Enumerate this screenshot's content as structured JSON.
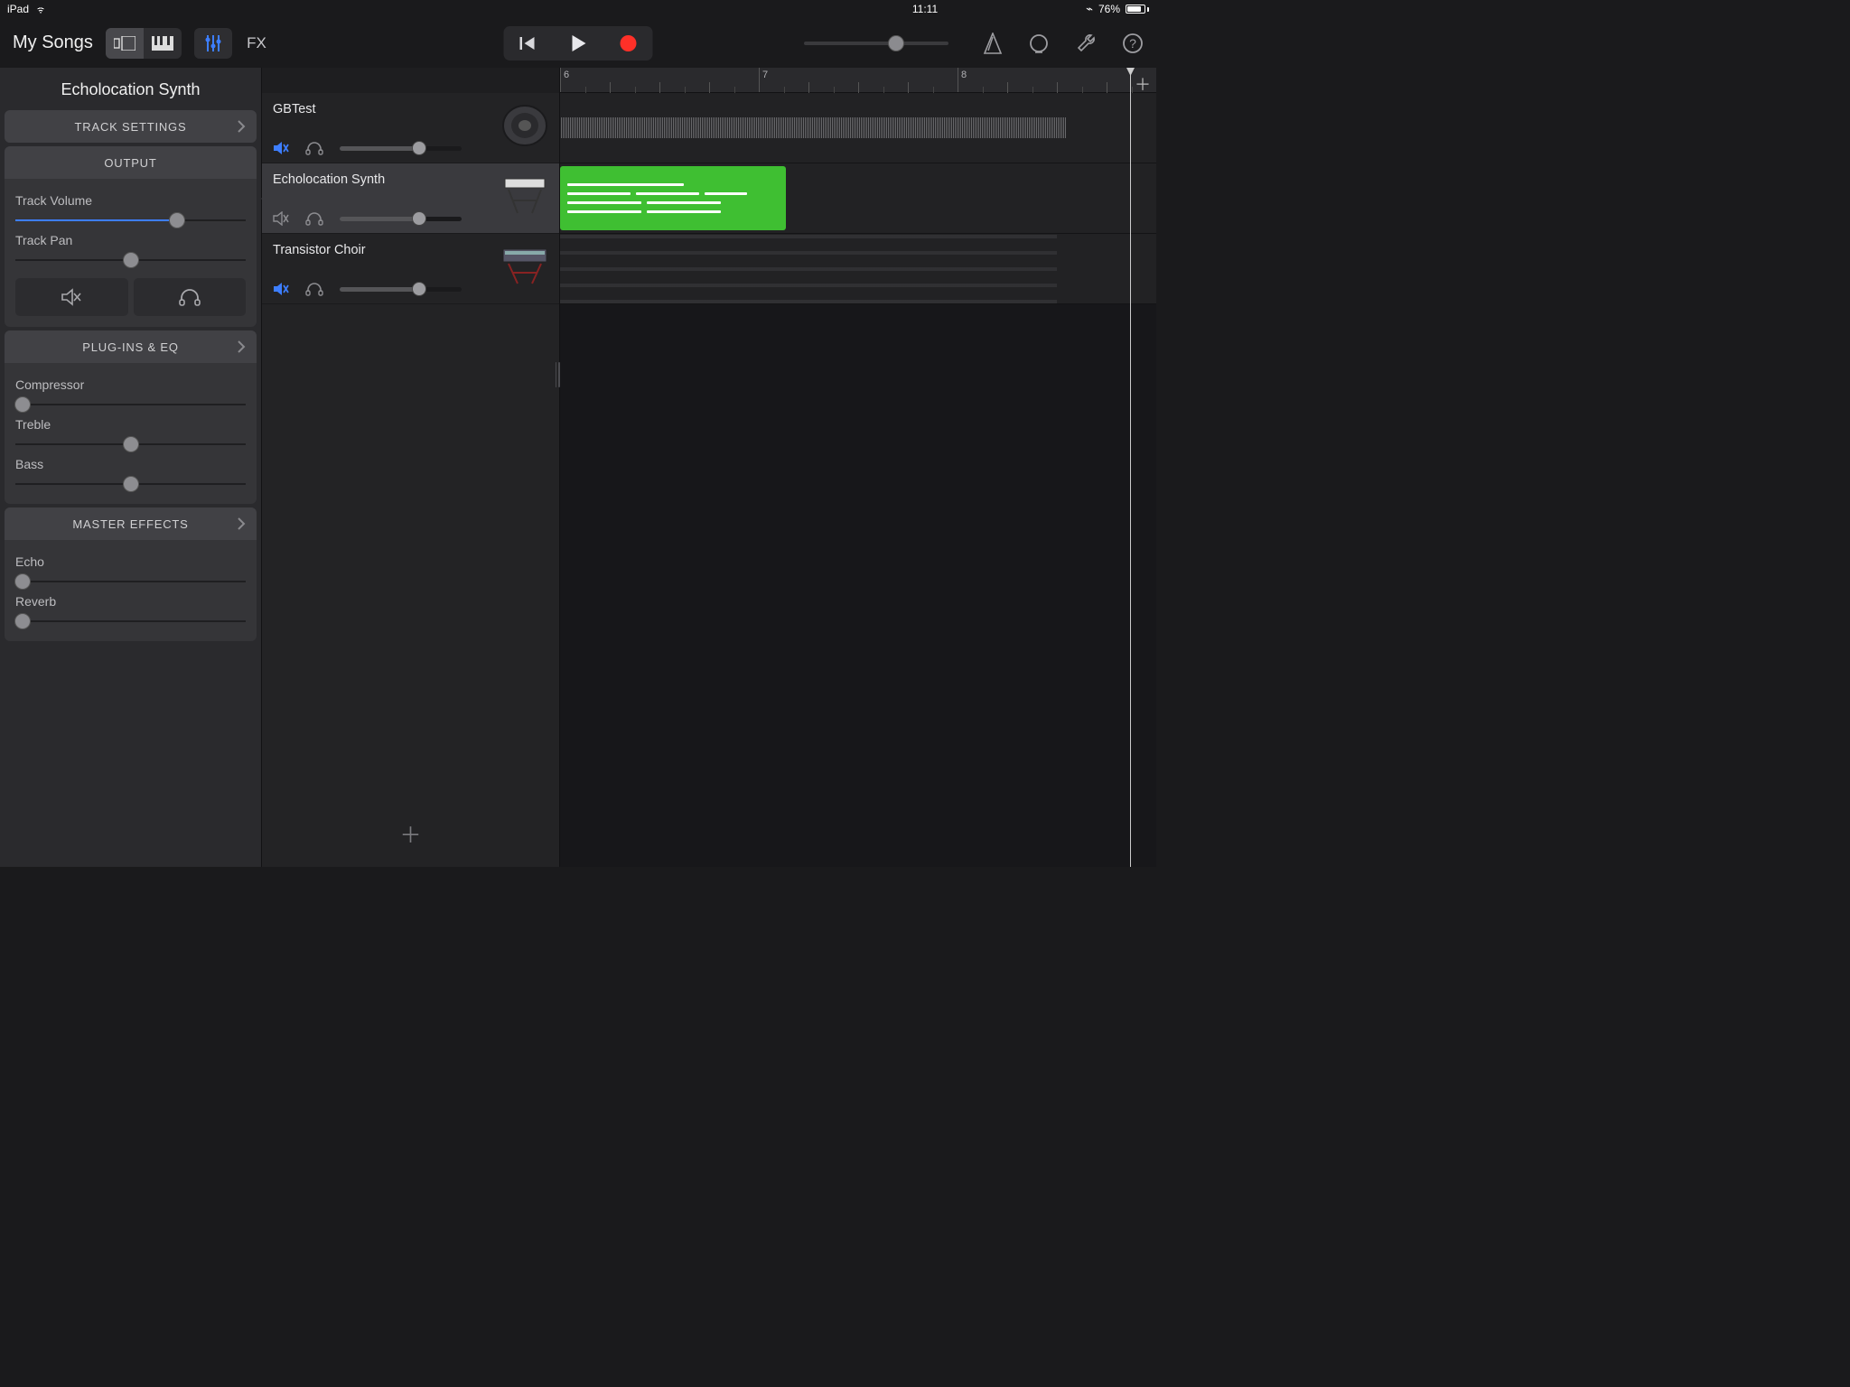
{
  "status": {
    "device": "iPad",
    "time": "11:11",
    "battery": "76%"
  },
  "toolbar": {
    "back": "My Songs",
    "fx_label": "FX"
  },
  "panel": {
    "title": "Echolocation Synth",
    "track_settings": "TRACK SETTINGS",
    "output": "OUTPUT",
    "track_volume": "Track Volume",
    "track_pan": "Track Pan",
    "plugins": "PLUG-INS & EQ",
    "compressor": "Compressor",
    "treble": "Treble",
    "bass": "Bass",
    "master_effects": "MASTER EFFECTS",
    "echo": "Echo",
    "reverb": "Reverb",
    "volume_pct": 70,
    "pan_pct": 50,
    "compressor_pct": 3,
    "treble_pct": 50,
    "bass_pct": 50,
    "echo_pct": 3,
    "reverb_pct": 3
  },
  "tracks": [
    {
      "name": "GBTest",
      "muted": true,
      "vol": 65,
      "instrument": "speaker"
    },
    {
      "name": "Echolocation Synth",
      "muted": false,
      "vol": 65,
      "instrument": "keys",
      "selected": true
    },
    {
      "name": "Transistor Choir",
      "muted": true,
      "vol": 65,
      "instrument": "synth"
    }
  ],
  "ruler": {
    "bars": [
      "6",
      "7",
      "8"
    ]
  },
  "colors": {
    "accent_blue": "#3d7eff",
    "region_green": "#3fbf32",
    "record_red": "#ff3028"
  }
}
